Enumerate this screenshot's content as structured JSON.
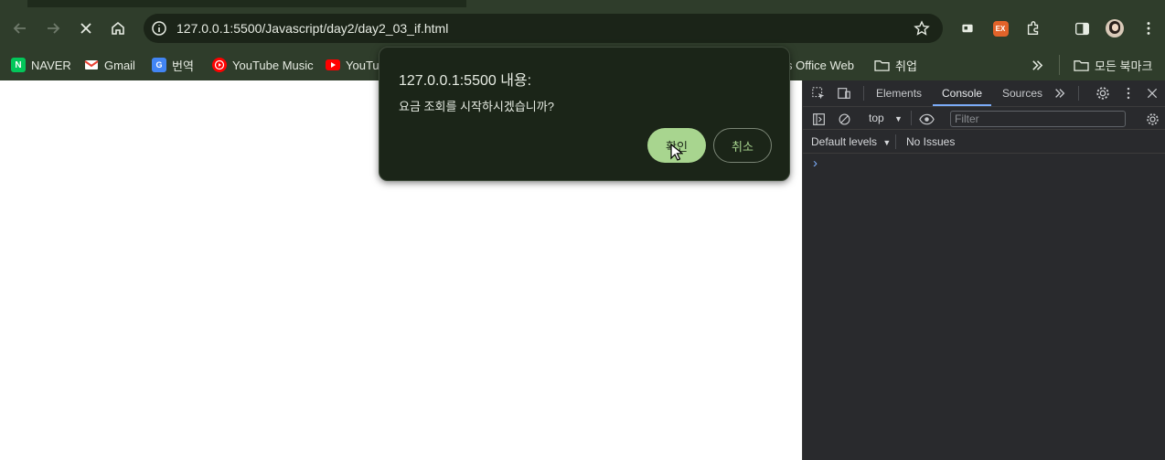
{
  "browser": {
    "url": "127.0.0.1:5500/Javascript/day2/day2_03_if.html",
    "colors": {
      "frame": "#2f3d2b",
      "omnibox": "#1b2418",
      "text": "#e7ece3",
      "accent": "#a8d58f"
    }
  },
  "bookmarks": {
    "items": [
      {
        "label": "NAVER",
        "icon": "naver-icon"
      },
      {
        "label": "Gmail",
        "icon": "gmail-icon"
      },
      {
        "label": "번역",
        "icon": "translate-icon"
      },
      {
        "label": "YouTube Music",
        "icon": "youtube-music-icon"
      },
      {
        "label": "YouTub",
        "icon": "youtube-icon"
      },
      {
        "label": "s Office Web",
        "icon": "none"
      },
      {
        "label": "취업",
        "icon": "folder-icon"
      }
    ],
    "all_bookmarks": "모든 북마크"
  },
  "dialog": {
    "title": "127.0.0.1:5500 내용:",
    "message": "요금 조회를 시작하시겠습니까?",
    "ok_label": "확인",
    "cancel_label": "취소"
  },
  "devtools": {
    "tabs": [
      "Elements",
      "Console",
      "Sources"
    ],
    "active_tab": "Console",
    "context": "top",
    "filter_placeholder": "Filter",
    "levels": "Default levels",
    "issues": "No Issues",
    "prompt": "›"
  }
}
